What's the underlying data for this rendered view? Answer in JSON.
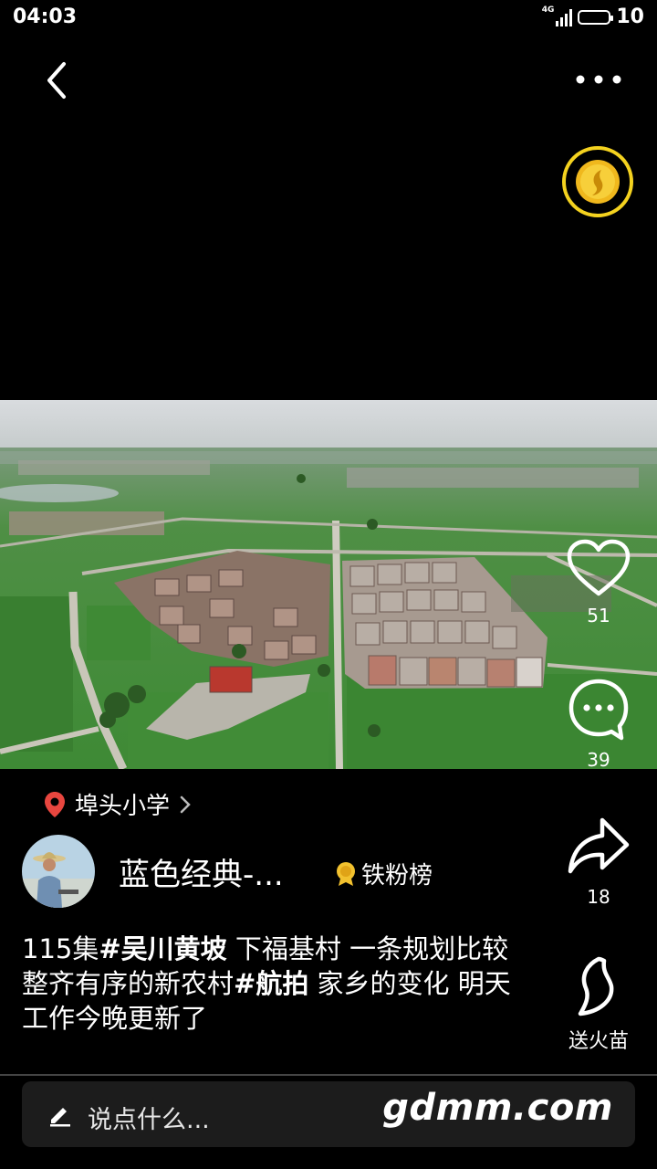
{
  "status_bar": {
    "time": "04:03",
    "network": "4G",
    "battery": "10"
  },
  "location": {
    "name": "埠头小学"
  },
  "author": {
    "name": "蓝色经典-...",
    "fans_label": "铁粉榜"
  },
  "actions": {
    "likes": "51",
    "comments": "39",
    "shares": "18",
    "gift_label": "送火苗"
  },
  "caption": {
    "part1": "115集",
    "tag1": "#吴川黄坡",
    "part2": " 下福基村 一条规划比较整齐有序的新农村",
    "tag2": "#航拍",
    "part3": " 家乡的变化 明天工作今晚更新了"
  },
  "comment_input": {
    "placeholder": "说点什么..."
  },
  "watermark": "gdmm.com",
  "colors": {
    "coin_ring": "#f4d21f",
    "location_pin": "#e8463f",
    "medal": "#f2c12e"
  }
}
